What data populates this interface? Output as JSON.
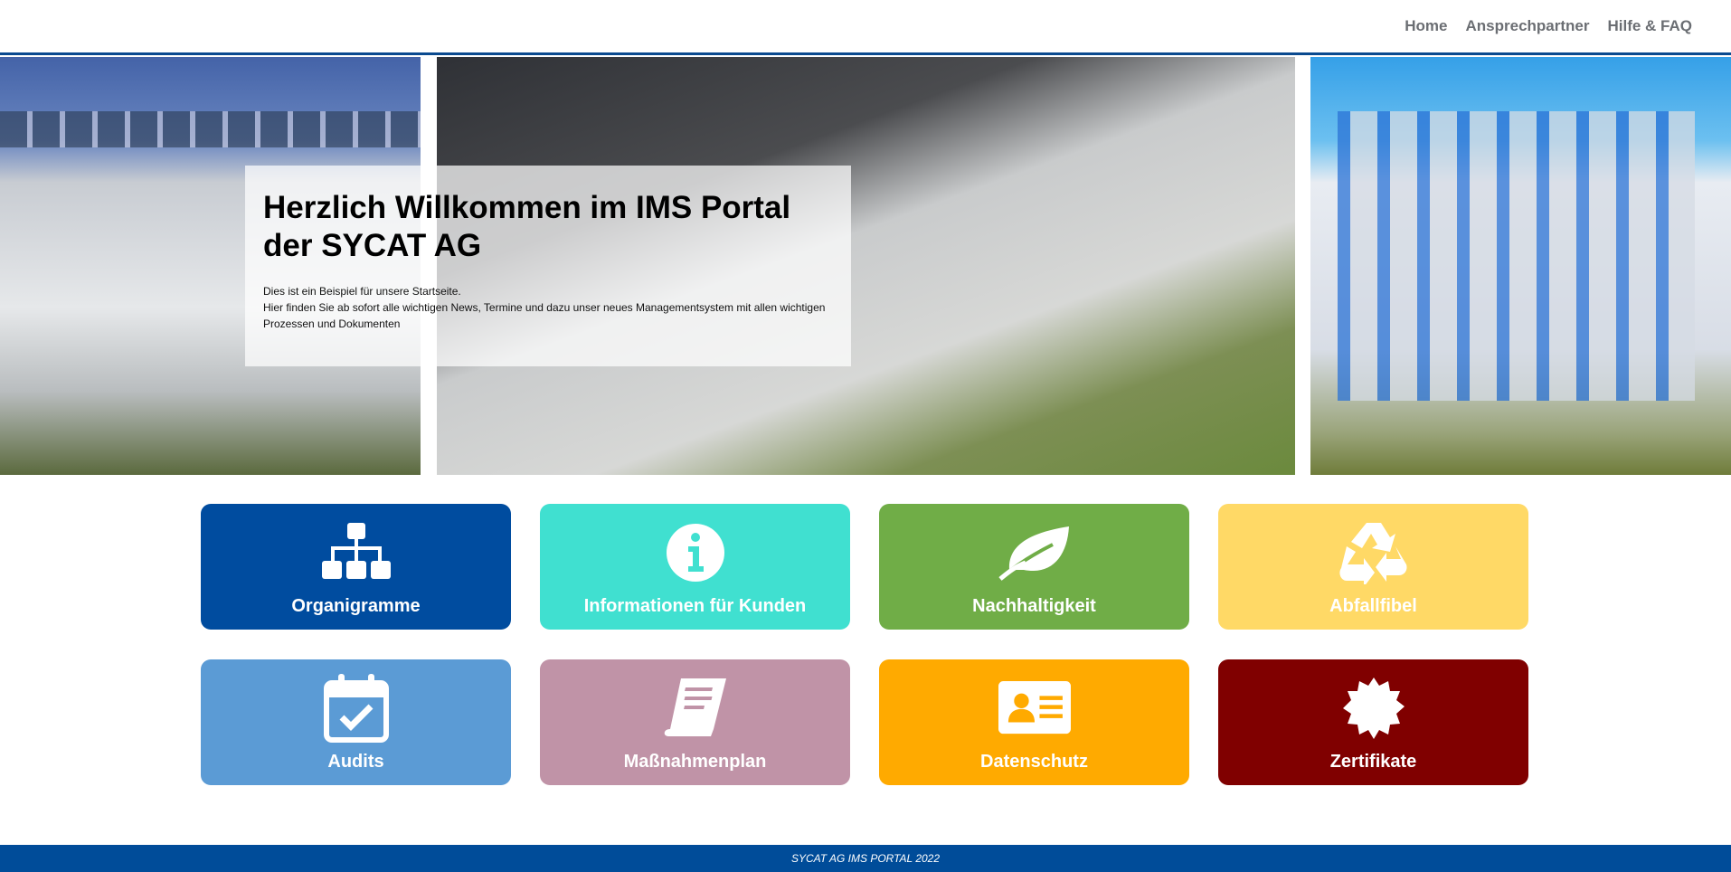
{
  "nav": {
    "items": [
      "Home",
      "Ansprechpartner",
      "Hilfe & FAQ"
    ]
  },
  "hero": {
    "title_line1": "Herzlich Willkommen im IMS Portal",
    "title_line2": "der SYCAT AG",
    "text_line1": "Dies ist ein Beispiel für unsere Startseite.",
    "text_line2": "Hier finden Sie ab sofort alle wichtigen News, Termine und dazu unser neues Managementsystem mit allen wichtigen Prozessen und Dokumenten"
  },
  "tiles": [
    {
      "label": "Organigramme",
      "color": "#004c9f",
      "icon": "org-chart-icon"
    },
    {
      "label": "Informationen für Kunden",
      "color": "#40e0d0",
      "icon": "info-icon"
    },
    {
      "label": "Nachhaltigkeit",
      "color": "#70ad47",
      "icon": "leaf-icon"
    },
    {
      "label": "Abfallfibel",
      "color": "#ffd966",
      "icon": "recycle-icon"
    },
    {
      "label": "Audits",
      "color": "#5b9bd5",
      "icon": "calendar-check-icon"
    },
    {
      "label": "Maßnahmenplan",
      "color": "#c093a7",
      "icon": "book-icon"
    },
    {
      "label": "Datenschutz",
      "color": "#ffaa00",
      "icon": "id-card-icon"
    },
    {
      "label": "Zertifikate",
      "color": "#800000",
      "icon": "certificate-seal-icon"
    }
  ],
  "footer": {
    "text": "SYCAT AG IMS PORTAL 2022"
  }
}
